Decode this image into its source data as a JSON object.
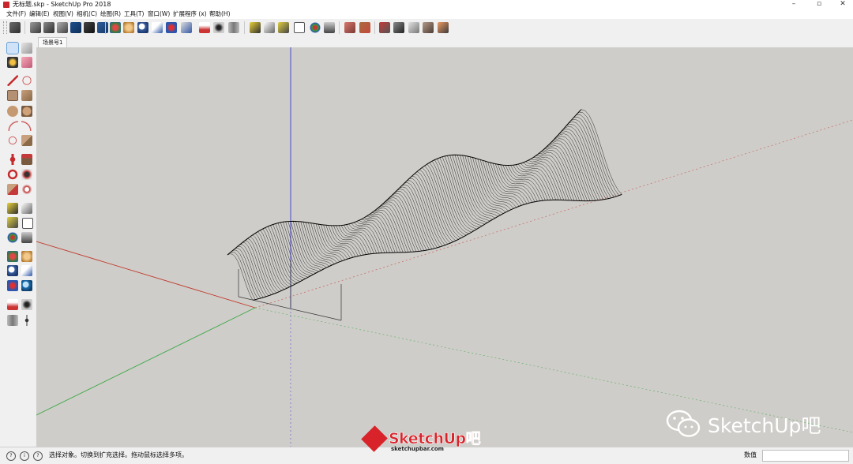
{
  "window": {
    "title": "无标题.skp - SketchUp Pro 2018",
    "minimize": "–",
    "maximize": "▫",
    "close": "✕"
  },
  "menu": [
    {
      "label": "文件(F)"
    },
    {
      "label": "编辑(E)"
    },
    {
      "label": "视图(V)"
    },
    {
      "label": "相机(C)"
    },
    {
      "label": "绘图(R)"
    },
    {
      "label": "工具(T)"
    },
    {
      "label": "窗口(W)"
    },
    {
      "label": "扩展程序 (x)"
    },
    {
      "label": "帮助(H)"
    }
  ],
  "scene": {
    "tab_label": "场景号1"
  },
  "status": {
    "hint": "选择对象。切换到扩充选择。拖动鼠标选择多项。",
    "measure_label": "数值",
    "measure_value": ""
  },
  "watermark": {
    "logo_text": "SketchUp吧",
    "logo_url": "sketchupbar.com",
    "wechat_text": "SketchUp吧"
  },
  "colors": {
    "viewport_bg": "#cfcdc9",
    "axis_red": "#c0392b",
    "axis_green": "#3aa845",
    "axis_blue": "#3c3ccc",
    "brand_red": "#d9232a"
  }
}
